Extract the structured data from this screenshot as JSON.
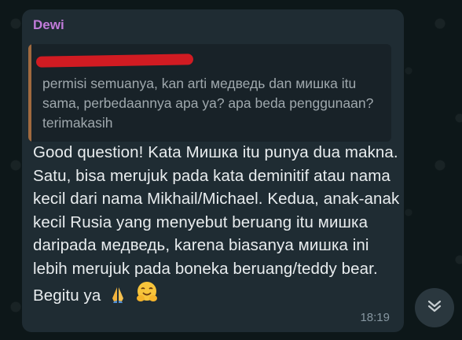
{
  "message": {
    "sender": "Dewi",
    "quoted_text": "permisi semuanya, kan arti медведь dan мишка itu sama, perbedaannya apa ya? apa beda penggunaan? terimakasih",
    "body": "Good question! Kata Мишка itu punya dua makna. Satu, bisa merujuk pada kata deminitif atau nama kecil dari nama Mikhail/Michael. Kedua, anak-anak kecil Rusia yang menyebut beruang itu мишка daripada медведь, karena biasanya мишка ini lebih merujuk pada boneka beruang/teddy bear. Begitu ya",
    "emojis": [
      "folded-hands-icon",
      "hugging-face-icon"
    ],
    "time": "18:19"
  },
  "scroll_button": {
    "icon": "double-chevron-down-icon"
  },
  "colors": {
    "bubble": "#1f2c33",
    "sender": "#c17bd9",
    "quote_bar": "#a06a3f",
    "redaction": "#d11b22",
    "text": "#e9edef",
    "muted": "#8696a0"
  }
}
